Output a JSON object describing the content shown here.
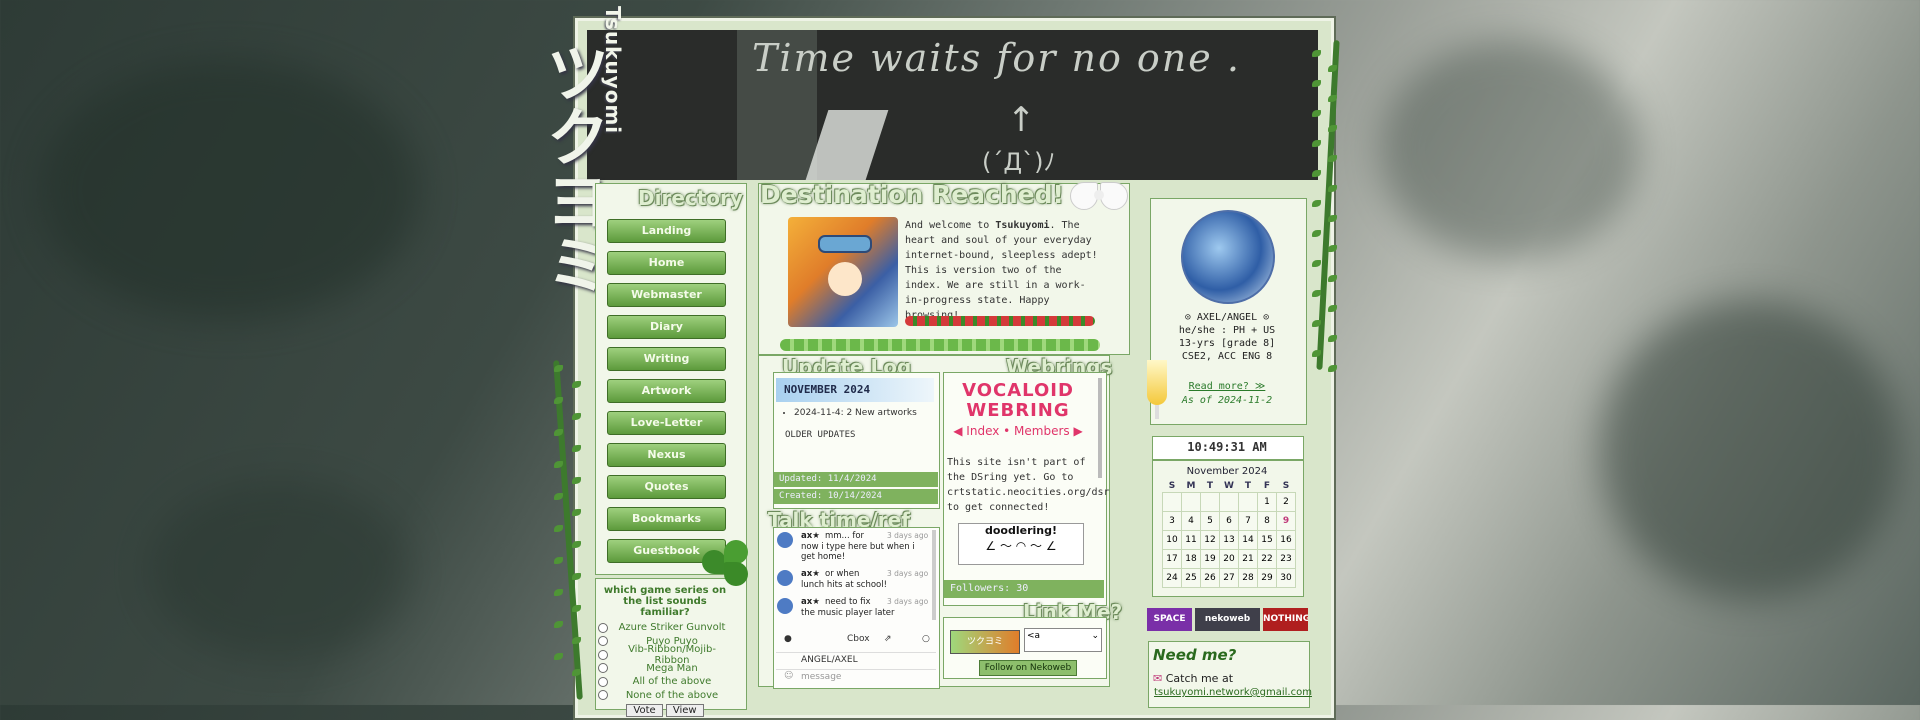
{
  "brand": {
    "romaji": "Tsukuyomi",
    "katakana": "ツクヨミ"
  },
  "header": {
    "scrawl": "Time waits for no one .",
    "arrow": "↑",
    "face": "(ˊДˋ)ﾉ"
  },
  "directory": {
    "title": "Directory",
    "items": [
      "Landing",
      "Home",
      "Webmaster",
      "Diary",
      "Writing",
      "Artwork",
      "Love-Letter",
      "Nexus",
      "Quotes",
      "Bookmarks",
      "Guestbook"
    ]
  },
  "poll": {
    "question": "which game series on the list sounds familiar?",
    "options": [
      "Azure Striker Gunvolt",
      "Puyo Puyo",
      "Vib-Ribbon/Mojib-Ribbon",
      "Mega Man",
      "All of the above",
      "None of the above"
    ],
    "vote_label": "Vote",
    "view_label": "View"
  },
  "welcome": {
    "title": "Destination Reached!",
    "intro": "And welcome to ",
    "site": "Tsukuyomi",
    "body": ". The heart and soul of your everyday internet-bound, sleepless adept! This is version two of the index. We are still in a work-in-progress state. Happy browsing!"
  },
  "update_log": {
    "title": "Update Log",
    "month": "NOVEMBER 2024",
    "entries": [
      "2024-11-4: 2 New artworks"
    ],
    "older": "OLDER UPDATES",
    "updated": "Updated: 11/4/2024",
    "created": "Created: 10/14/2024"
  },
  "webrings": {
    "title": "Webrings",
    "vocaloid_line1": "VOCALOID",
    "vocaloid_line2": "WEBRING",
    "vocaloid_links": "◀ Index • Members ▶",
    "dsring_note": "This site isn't part of the DSring yet. Go to crtstatic.neocities.org/dsr to get connected!",
    "doodle": "doodlering!",
    "followers": "Followers: 30"
  },
  "talk": {
    "title": "Talk time/ref",
    "messages": [
      {
        "name": "ax★",
        "line1": "mm... for",
        "time": "3 days ago",
        "text": "now i type here but when i get home!"
      },
      {
        "name": "ax★",
        "line1": "or when",
        "time": "3 days ago",
        "text": "lunch hits at school!"
      },
      {
        "name": "ax★",
        "line1": "need to fix",
        "time": "3 days ago",
        "text": "the music player later"
      }
    ],
    "cbox_label": "Cbox",
    "name_value": "ANGEL/AXEL",
    "message_placeholder": "message"
  },
  "link_me": {
    "title": "Link Me?",
    "select_value": "<a",
    "follow_label": "Follow on Nekoweb"
  },
  "profile": {
    "line1": "⊙ AXEL/ANGEL ⊙",
    "line2": "he/she : PH + US",
    "line3": "13-yrs [grade 8]",
    "line4": "CSE2, ACC ENG 8",
    "read_more": "Read more? ≫",
    "as_of": "As of 2024-11-2"
  },
  "clock": {
    "time": "10:49:31 AM"
  },
  "calendar": {
    "month": "November 2024",
    "days": [
      "S",
      "M",
      "T",
      "W",
      "T",
      "F",
      "S"
    ],
    "weeks": [
      [
        "",
        "",
        "",
        "",
        "",
        "1",
        "2"
      ],
      [
        "3",
        "4",
        "5",
        "6",
        "7",
        "8",
        "9"
      ],
      [
        "10",
        "11",
        "12",
        "13",
        "14",
        "15",
        "16"
      ],
      [
        "17",
        "18",
        "19",
        "20",
        "21",
        "22",
        "23"
      ],
      [
        "24",
        "25",
        "26",
        "27",
        "28",
        "29",
        "30"
      ]
    ],
    "today": "9"
  },
  "badges": [
    "SPACE",
    "nekoweb",
    "NOTHING SPECIAL"
  ],
  "need_me": {
    "title": "Need me?",
    "catch": "Catch me at",
    "email": "tsukuyomi.network@gmail.com"
  },
  "colors": {
    "accent": "#5c9a3b",
    "panel": "#f2f7ea",
    "header": "#2a2c2a",
    "today": "#c03a7a"
  }
}
